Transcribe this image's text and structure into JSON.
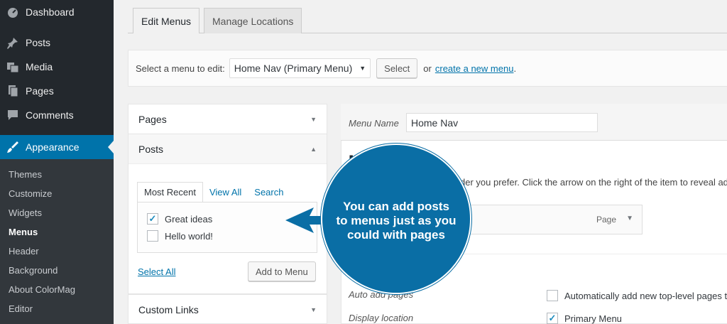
{
  "sidebar": {
    "items": [
      {
        "label": "Dashboard",
        "icon": "dashboard-icon"
      },
      {
        "label": "Posts",
        "icon": "pushpin-icon"
      },
      {
        "label": "Media",
        "icon": "media-icon"
      },
      {
        "label": "Pages",
        "icon": "pages-icon"
      },
      {
        "label": "Comments",
        "icon": "comments-icon"
      },
      {
        "label": "Appearance",
        "icon": "paintbrush-icon"
      }
    ],
    "submenu": [
      "Themes",
      "Customize",
      "Widgets",
      "Menus",
      "Header",
      "Background",
      "About ColorMag",
      "Editor"
    ]
  },
  "tabs": {
    "edit": "Edit Menus",
    "manage": "Manage Locations"
  },
  "select_bar": {
    "label": "Select a menu to edit:",
    "selected": "Home Nav (Primary Menu)",
    "button": "Select",
    "or_text": "or",
    "create_link": "create a new menu",
    "period": "."
  },
  "accordion": {
    "pages": "Pages",
    "posts": "Posts",
    "custom_links": "Custom Links",
    "inner_tabs": [
      "Most Recent",
      "View All",
      "Search"
    ],
    "posts_list": [
      {
        "label": "Great ideas",
        "checked": true
      },
      {
        "label": "Hello world!",
        "checked": false
      }
    ],
    "select_all": "Select All",
    "add_button": "Add to Menu"
  },
  "menu_edit": {
    "name_label": "Menu Name",
    "name_value": "Home Nav",
    "heading_partial": "M",
    "instructions_partial": "der you prefer. Click the arrow on the right of the item to reveal ad",
    "item_type": "Page",
    "auto_add_label": "Auto add pages",
    "auto_add_option": "Automatically add new top-level pages t",
    "display_location_label": "Display location",
    "display_location_option": "Primary Menu",
    "display_location_checked": true,
    "auto_add_checked": false
  },
  "callout": {
    "text": "You can add posts to menus just as you could with pages"
  },
  "colors": {
    "accent": "#0073aa",
    "callout": "#0a6ea5",
    "sidebar": "#23282d"
  }
}
